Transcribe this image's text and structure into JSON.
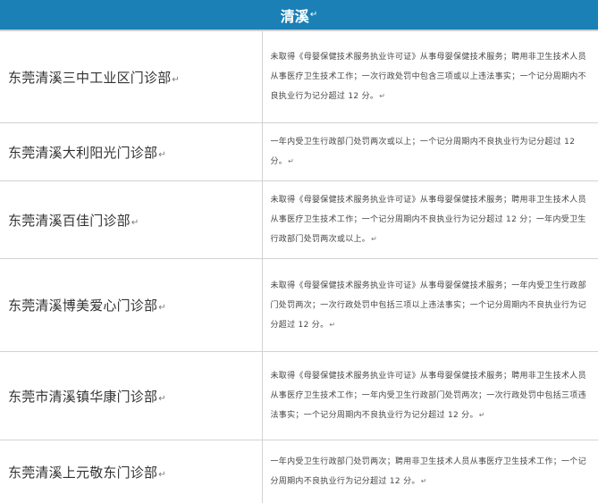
{
  "header": {
    "title": "清溪",
    "mark": "↵"
  },
  "para_mark": "↵",
  "rows": [
    {
      "name": "东莞清溪三中工业区门诊部",
      "desc": "未取得《母婴保健技术服务执业许可证》从事母婴保健技术服务；聘用非卫生技术人员从事医疗卫生技术工作；一次行政处罚中包含三项或以上违法事实；一个记分周期内不良执业行为记分超过 12 分。"
    },
    {
      "name": "东莞清溪大利阳光门诊部",
      "desc": "一年内受卫生行政部门处罚两次或以上；一个记分周期内不良执业行为记分超过 12 分。"
    },
    {
      "name": "东莞清溪百佳门诊部",
      "desc": "未取得《母婴保健技术服务执业许可证》从事母婴保健技术服务；聘用非卫生技术人员从事医疗卫生技术工作；一个记分周期内不良执业行为记分超过 12 分；一年内受卫生行政部门处罚两次或以上。"
    },
    {
      "name": "东莞清溪博美爱心门诊部",
      "desc": "未取得《母婴保健技术服务执业许可证》从事母婴保健技术服务；一年内受卫生行政部门处罚两次；一次行政处罚中包括三项以上违法事实；一个记分周期内不良执业行为记分超过 12 分。"
    },
    {
      "name": "东莞市清溪镇华康门诊部",
      "desc": "未取得《母婴保健技术服务执业许可证》从事母婴保健技术服务；聘用非卫生技术人员从事医疗卫生技术工作；一年内受卫生行政部门处罚两次；一次行政处罚中包括三项违法事实；一个记分周期内不良执业行为记分超过 12 分。"
    },
    {
      "name": "东莞清溪上元敬东门诊部",
      "desc": "一年内受卫生行政部门处罚两次；聘用非卫生技术人员从事医疗卫生技术工作；一个记分周期内不良执业行为记分超过 12 分。"
    }
  ]
}
